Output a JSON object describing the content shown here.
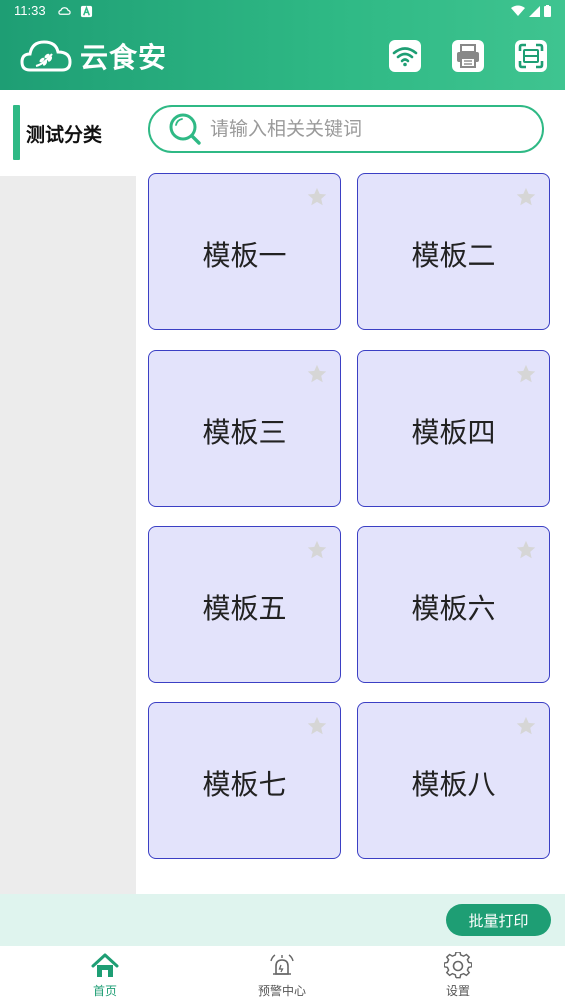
{
  "status": {
    "time": "11:33"
  },
  "app": {
    "brand": "云食安"
  },
  "header": {
    "icons": [
      "wifi-icon",
      "printer-icon",
      "scan-icon"
    ]
  },
  "sidebar": {
    "categories": [
      {
        "label": "测试分类",
        "active": true
      }
    ]
  },
  "search": {
    "placeholder": "请输入相关关键词",
    "value": ""
  },
  "templates": [
    {
      "label": "模板一"
    },
    {
      "label": "模板二"
    },
    {
      "label": "模板三"
    },
    {
      "label": "模板四"
    },
    {
      "label": "模板五"
    },
    {
      "label": "模板六"
    },
    {
      "label": "模板七"
    },
    {
      "label": "模板八"
    }
  ],
  "actions": {
    "batch_print": "批量打印"
  },
  "bottom_nav": [
    {
      "label": "首页",
      "icon": "home-icon",
      "active": true
    },
    {
      "label": "预警中心",
      "icon": "alarm-icon",
      "active": false
    },
    {
      "label": "设置",
      "icon": "gear-icon",
      "active": false
    }
  ],
  "colors": {
    "primary": "#2fb985",
    "card_bg": "#e3e3fb",
    "card_border": "#3b3fc4"
  }
}
